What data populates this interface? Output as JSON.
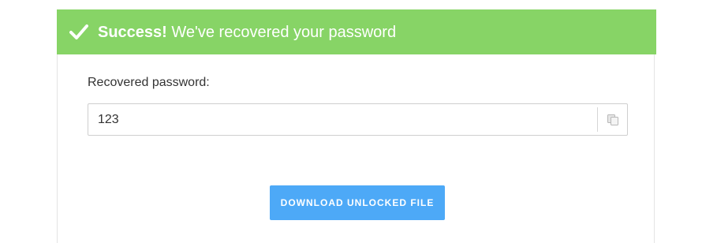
{
  "banner": {
    "icon": "check-icon",
    "strong_text": "Success!",
    "message": " We've recovered your password",
    "background_color": "#87d466"
  },
  "password_section": {
    "label": "Recovered password:",
    "value": "123",
    "copy_icon": "copy-icon"
  },
  "actions": {
    "download_label": "DOWNLOAD UNLOCKED FILE",
    "download_color": "#4da9f7"
  }
}
